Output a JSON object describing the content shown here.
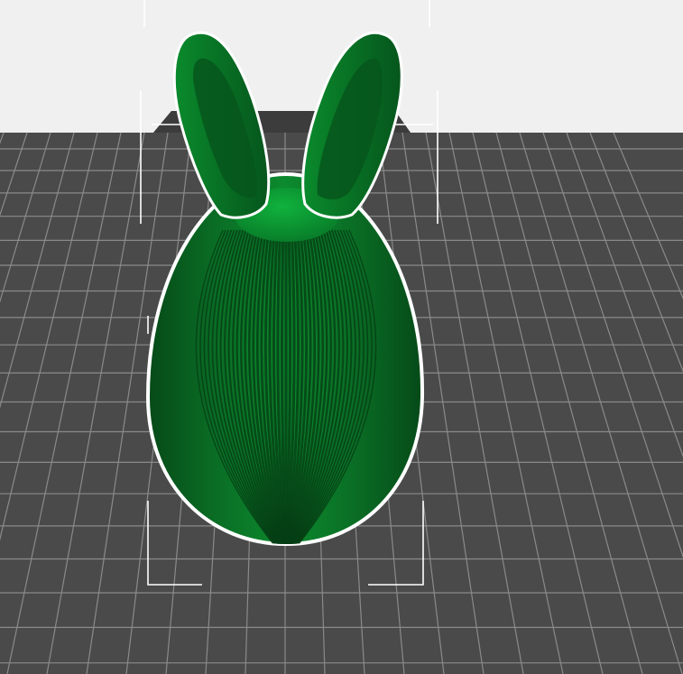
{
  "viewport": {
    "model": "bunny-egg",
    "colors": {
      "background": "#f0f0f0",
      "bed": "#4a4a4a",
      "bed_back_edge": "#3c3c3c",
      "grid_line": "#8c8c8c",
      "model_green": "#0b7a2a",
      "model_dark": "#064d1a",
      "selection_outline": "#ffffff",
      "bounding_box_corner": "#ffffff"
    },
    "parts": {
      "egg": "ribbed-egg-body",
      "left_ear": "bunny-ear-left",
      "right_ear": "bunny-ear-right",
      "cap": "ear-mount-cap"
    }
  }
}
